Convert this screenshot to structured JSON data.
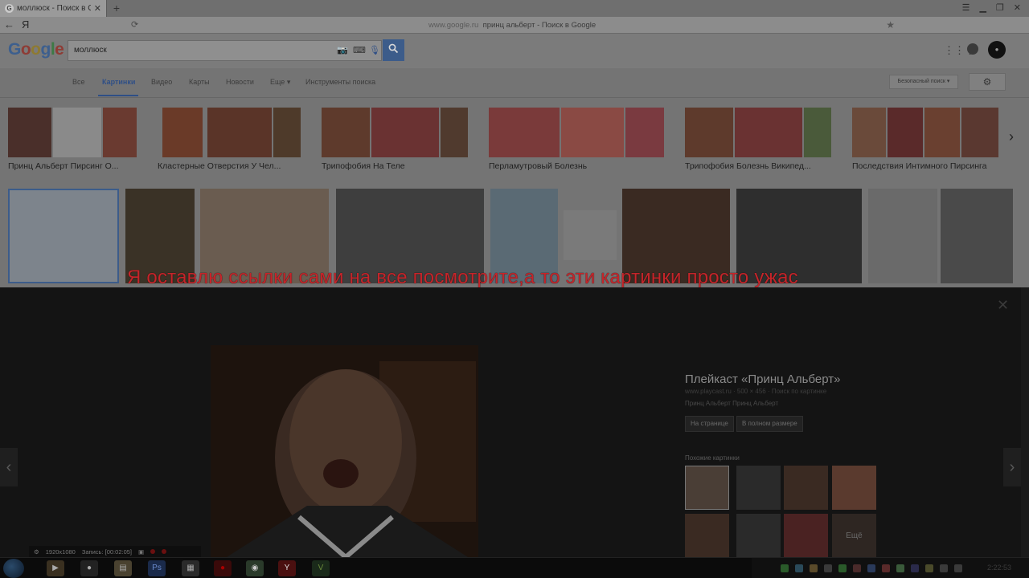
{
  "browser": {
    "tab_title": "моллюск - Поиск в Google",
    "tab_favicon": "G",
    "tab_close": "✕",
    "new_tab": "+",
    "back": "←",
    "yandex_logo": "Я",
    "url_host": "www.google.ru",
    "url_title": "принц альберт - Поиск в Google"
  },
  "google": {
    "logo": "Google",
    "search_value": "моллюск",
    "nav": [
      "Все",
      "Картинки",
      "Видео",
      "Карты",
      "Новости",
      "Еще ▾",
      "Инструменты поиска"
    ],
    "safe_search": "Безопасный поиск ▾"
  },
  "related": [
    {
      "caption": "Принц Альберт Пирсинг О..."
    },
    {
      "caption": "Кластерные Отверстия У Чел..."
    },
    {
      "caption": "Трипофобия На Теле"
    },
    {
      "caption": "Перламутровый Болезнь"
    },
    {
      "caption": "Трипофобия Болезнь Википед..."
    },
    {
      "caption": "Последствия Интимного Пирсинга"
    }
  ],
  "overlay_text": "Я оставлю ссылки сами на все посмотрите,а то эти картинки просто ужас",
  "preview": {
    "title": "Плейкаст «Принц Альберт»",
    "meta": "www.playcast.ru · 500 × 456 · Поиск по картинке",
    "desc": "Принц Альберт Принц Альберт",
    "btn_page": "На странице",
    "btn_full": "В полном размере",
    "similar_label": "Похожие картинки",
    "more_label": "Ещё"
  },
  "recorder": {
    "resolution": "1920x1080",
    "status": "Запись: [00:02:05]"
  },
  "taskbar": {
    "time": "2:22:53"
  },
  "colors": {
    "accent_blue": "#2f4f86",
    "overlay_red": "#c5252a",
    "panel_bg": "#141414"
  }
}
